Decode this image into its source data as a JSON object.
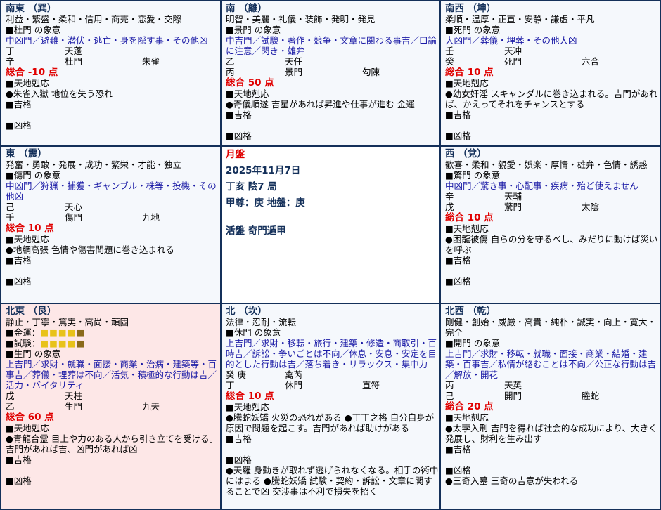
{
  "colors": {
    "border": "#14305a",
    "accent_red": "#e00000",
    "link_blue": "#1a1aa6",
    "highlight_pink": "#fde7e7"
  },
  "cells": {
    "se": {
      "dir": "南東 （巽）",
      "traits": "利益・繁盛・柔和・信用・商売・恋愛・交際",
      "door_head": "■杜門 の象意",
      "door_text": "中凶門／避難・潜伏・逃亡・身を隠す事・その他凶",
      "r1": [
        "丁",
        "天蓬",
        ""
      ],
      "r2": [
        "辛",
        "杜門",
        "朱雀"
      ],
      "score": "総合 -10 点",
      "resp": "■天地剋応",
      "resp_text": "●朱雀入獄 地位を失う恐れ",
      "good": "■吉格",
      "bad": "■凶格"
    },
    "s": {
      "dir": "南 （離）",
      "traits": "明智・美麗・礼儀・装飾・発明・発見",
      "door_head": "■景門 の象意",
      "door_text": "中吉門／試験・著作・競争・文章に関わる事吉／口論に注意／閃き・雄弁",
      "r1": [
        "乙",
        "天任",
        ""
      ],
      "r2": [
        "丙",
        "景門",
        "勾陳"
      ],
      "score": "総合 50 点",
      "resp": "■天地剋応",
      "resp_text": "●奇儀順遂 吉星があれば昇進や仕事が進む 金運",
      "good": "■吉格",
      "bad": "■凶格"
    },
    "sw": {
      "dir": "南西 （坤）",
      "traits": "柔順・温厚・正直・安静・謙虚・平凡",
      "door_head": "■死門 の象意",
      "door_text": "大凶門／葬儀・埋葬・その他大凶",
      "r1": [
        "壬",
        "天冲",
        ""
      ],
      "r2": [
        "癸",
        "死門",
        "六合"
      ],
      "score": "総合 10 点",
      "resp": "■天地剋応",
      "resp_text": "●幼女奸淫 スキャンダルに巻き込まれる。吉門があれば、かえってそれをチャンスとする",
      "good": "■吉格",
      "bad": "■凶格"
    },
    "e": {
      "dir": "東 （震）",
      "traits": "発奮・勇敢・発展・成功・繁栄・才能・独立",
      "door_head": "■傷門 の象意",
      "door_text": "中凶門／狩猟・捕獲・ギャンブル・株等・投機・その他凶",
      "r1": [
        "己",
        "天心",
        ""
      ],
      "r2": [
        "壬",
        "傷門",
        "九地"
      ],
      "score": "総合 10 点",
      "resp": "■天地剋応",
      "resp_text": "●地網高張 色情や傷害問題に巻き込まれる",
      "good": "■吉格",
      "bad": "■凶格"
    },
    "center": {
      "label": "月盤",
      "date": "2025年11月7日",
      "ganzhi": "丁亥 陰7 局",
      "deity": "甲尊：庚 地盤：庚",
      "method": "活盤 奇門遁甲"
    },
    "w": {
      "dir": "西 （兌）",
      "traits": "歓喜・柔和・親愛・娯楽・厚情・雄弁・色情・誘惑",
      "door_head": "■驚門 の象意",
      "door_text": "中凶門／驚き事・心配事・疾病・殆ど使えません",
      "r1": [
        "辛",
        "天輔",
        ""
      ],
      "r2": [
        "戊",
        "驚門",
        "太陰"
      ],
      "score": "総合 10 点",
      "resp": "■天地剋応",
      "resp_text": "●困龍被傷 自らの分を守るべし、みだりに動けば災いを呼ぶ",
      "good": "■吉格",
      "bad": "■凶格"
    },
    "ne": {
      "dir": "北東 （艮）",
      "traits": "静止・丁寧・篤実・高尚・頑固",
      "money": "■金運：",
      "exam": "■試験：",
      "money_level": "4/5",
      "exam_level": "4/5",
      "door_head": "■生門 の象意",
      "door_text": "上吉門／求財・就職・面接・商業・治病・建築等・百事吉／葬儀・埋葬は不向／活気・積極的な行動は吉／活力・バイタリティ",
      "r1": [
        "戊",
        "天柱",
        ""
      ],
      "r2": [
        "乙",
        "生門",
        "九天"
      ],
      "score": "総合 60 点",
      "resp": "■天地剋応",
      "resp_text": "●青龍合霊 目上や力のある人から引き立てを受ける。吉門があれば吉、凶門があれば凶",
      "good": "■吉格",
      "bad": "■凶格"
    },
    "n": {
      "dir": "北 （坎）",
      "traits": "法律・忍耐・流転",
      "door_head": "■休門 の象意",
      "door_text": "上吉門／求財・移転・旅行・建築・修造・商取引・百時吉／訴訟・争いごとは不向／休息・安息・安定を目的とした行動は吉／落ち着き・リラックス・集中力",
      "r1": [
        "癸 庚",
        "禽芮",
        ""
      ],
      "r2": [
        "丁",
        "休門",
        "直符"
      ],
      "score": "総合 10 点",
      "resp": "■天地剋応",
      "resp_text": "●騰蛇妖矯 火災の恐れがある ●丁丁之格 自分自身が原因で問題を起こす。吉門があれば助けがある",
      "good": "■吉格",
      "bad": "■凶格",
      "bad_text": "●天羅 身動きが取れず逃げられなくなる。相手の術中にはまる ●騰蛇妖矯 試験・契約・訴訟・文章に関することで凶 交渉事は不利で損失を招く"
    },
    "nw": {
      "dir": "北西 （乾）",
      "traits": "剛健・創始・威厳・高貴・純朴・誠実・向上・寛大・完全",
      "door_head": "■開門 の象意",
      "door_text": "上吉門／求財・移転・就職・面接・商業・結婚・建築・百事吉／私情が絡むことは不向／公正な行動は吉／解放・開花",
      "r1": [
        "丙",
        "天英",
        ""
      ],
      "r2": [
        "己",
        "開門",
        "螣蛇"
      ],
      "score": "総合 20 点",
      "resp": "■天地剋応",
      "resp_text": "●太孛入刑 吉門を得れば社会的な成功により、大きく発展し、財利を生み出す",
      "good": "■吉格",
      "bad": "■凶格",
      "bad_text": "●三奇入墓 三奇の吉意が失われる"
    }
  }
}
